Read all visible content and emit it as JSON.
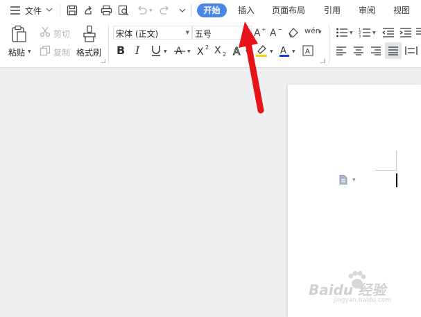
{
  "topbar": {
    "menu_label": "文件",
    "tabs": [
      "开始",
      "插入",
      "页面布局",
      "引用",
      "审阅",
      "视图"
    ]
  },
  "clipboard": {
    "paste_label": "粘贴",
    "cut_label": "剪切",
    "copy_label": "复制",
    "format_painter_label": "格式刷"
  },
  "font": {
    "family": "宋体 (正文)",
    "size": "五号",
    "phonetic_glyph": "wén"
  },
  "colors": {
    "active_tab": "#4a86e8",
    "arrow": "#e8121a",
    "font_color_bar": "#1a3bd6",
    "highlight_bar": "#f5d800"
  },
  "watermark": {
    "text": "Baidu 经验",
    "url": "jingyan.baidu.com"
  }
}
